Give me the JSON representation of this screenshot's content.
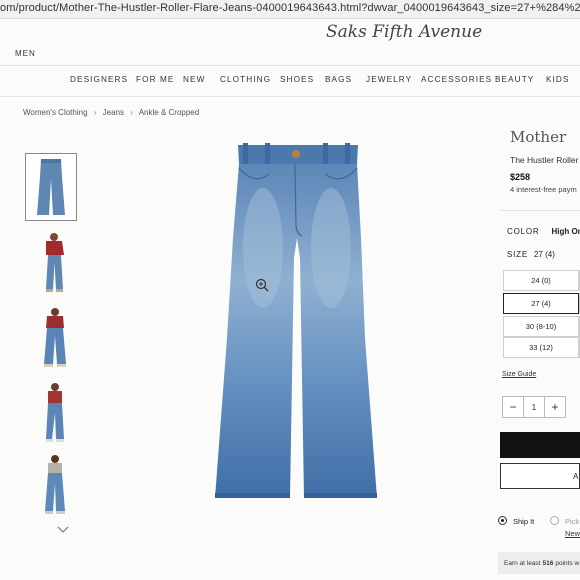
{
  "browser": {
    "url": "om/product/Mother-The-Hustler-Roller-Flare-Jeans-0400019643643.html?dwvar_0400019643643_size=27+%284%29&dwvar_0400019643643"
  },
  "header": {
    "brand": "Saks Fifth Avenue",
    "gender_link": "MEN",
    "nav": [
      "DESIGNERS",
      "FOR ME",
      "NEW",
      "CLOTHING",
      "SHOES",
      "BAGS",
      "JEWELRY",
      "ACCESSORIES",
      "BEAUTY",
      "KIDS"
    ]
  },
  "breadcrumb": [
    "Women's Clothing",
    "Jeans",
    "Ankle & Cropped"
  ],
  "gallery": {
    "thumbnails": [
      "jeans-flat",
      "model-red-top",
      "model-front",
      "model-side",
      "model-back"
    ],
    "accent_denim": "#5f87b4"
  },
  "product": {
    "vendor": "Mother",
    "name": "The Hustler Roller",
    "price": "$258",
    "installments": "4 interest-free paym",
    "color_label": "COLOR",
    "color_value": "High On",
    "size_label": "SIZE",
    "size_value": "27 (4)",
    "sizes": [
      "24 (0)",
      "27 (4)",
      "30 (8-10)",
      "33 (12)"
    ],
    "selected_size_index": 1,
    "size_guide": "Size Guide",
    "quantity": "1",
    "qty_minus": "−",
    "qty_plus": "+",
    "favorites_label": "ADD",
    "ship_label": "Ship It",
    "pickup_label": "Pick",
    "new_link": "New",
    "points_prefix": "Earn at least",
    "points_value": "516",
    "points_suffix": "points w"
  }
}
